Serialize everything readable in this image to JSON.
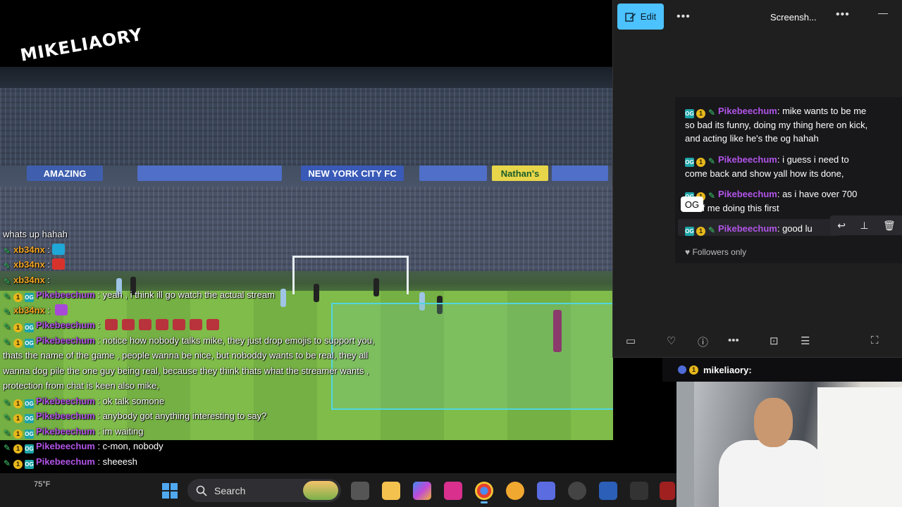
{
  "logo": {
    "text": "MIKELIAORY"
  },
  "stream": {
    "adboards": [
      "AMAZING",
      "NEW YORK CITY FC",
      "Nathan's"
    ],
    "chat": [
      {
        "user": "",
        "text": "whats up hahah",
        "badges": []
      },
      {
        "user": "xb34nx",
        "sep": " :",
        "text": "",
        "badges": [
          "pen"
        ],
        "color": "xb",
        "emote": "#1fa7d8"
      },
      {
        "user": "xb34nx",
        "sep": " :",
        "text": "",
        "badges": [
          "pen"
        ],
        "color": "xb",
        "emote": "#d8322c"
      },
      {
        "user": "xb34nx",
        "sep": " :",
        "text": "",
        "badges": [
          "pen"
        ],
        "color": "xb",
        "emote": ""
      },
      {
        "user": "Pikebeechum",
        "sep": " : ",
        "text": "yeah , i think ill go watch the actual stream",
        "badges": [
          "pen",
          "coin",
          "og"
        ],
        "color": "pike"
      },
      {
        "user": "xb34nx",
        "sep": " : ",
        "text": "",
        "badges": [
          "pen"
        ],
        "color": "xb",
        "emote": "#a84ad8"
      },
      {
        "user": "Pikebeechum",
        "sep": " : ",
        "text": "",
        "badges": [
          "pen",
          "coin",
          "og"
        ],
        "color": "pike",
        "emotes": 7
      },
      {
        "user": "Pikebeechum",
        "sep": " : ",
        "text": "notice how nobody talks mike, they just drop emojis to support you, thats the name of the game , people wanna be nice, but noboddy wants to be real, they all wanna dog pile the one guy being real, because they think thats what the streamer wants , protection from chat is keen also mike,",
        "badges": [
          "pen",
          "coin",
          "og"
        ],
        "color": "pike"
      },
      {
        "user": "Pikebeechum",
        "sep": " : ",
        "text": "ok talk somone",
        "badges": [
          "pen",
          "coin",
          "og"
        ],
        "color": "pike"
      },
      {
        "user": "Pikebeechum",
        "sep": " : ",
        "text": "anybody got anything interesting to say?",
        "badges": [
          "pen",
          "coin",
          "og"
        ],
        "color": "pike"
      },
      {
        "user": "Pikebeechum",
        "sep": " : ",
        "text": "im waiting",
        "badges": [
          "pen",
          "coin",
          "og"
        ],
        "color": "pike"
      },
      {
        "user": "Pikebeechum",
        "sep": " : ",
        "text": "c-mon, nobody",
        "badges": [
          "pen",
          "coin",
          "og"
        ],
        "color": "pike"
      },
      {
        "user": "Pikebeechum",
        "sep": " : ",
        "text": "sheeesh",
        "badges": [
          "pen",
          "coin",
          "og"
        ],
        "color": "pike"
      }
    ]
  },
  "right_chat_strip": {
    "user": "mikeliaory:"
  },
  "viewer": {
    "edit_label": "Edit",
    "more_label": "•••",
    "title": "Screensh...",
    "more2_label": "•••",
    "minimize_label": "—",
    "og_label": "OG",
    "followers_label": "Followers only",
    "messages": [
      {
        "user": "Pikebeechum",
        "lines": [
          "mike wants to be me",
          "so bad its funny, doing my thing here on kick,",
          "and acting like he's the og hahah"
        ]
      },
      {
        "user": "Pikebeechum",
        "lines": [
          "i guess i need to",
          "come back and show yall how its done,"
        ]
      },
      {
        "user": "Pikebeechum",
        "lines": [
          "as i have over 700",
          "os of me doing this first"
        ]
      },
      {
        "user": "Pikebeechum",
        "lines": [
          "good lu"
        ]
      }
    ],
    "bottom_icons": [
      "filmstrip-icon",
      "heart-icon",
      "info-icon",
      "more-icon",
      "crop-icon",
      "adjust-icon",
      "fullscreen-icon"
    ]
  },
  "taskbar": {
    "weather": "75°F",
    "search_label": "Search"
  },
  "colors": {
    "accent": "#4cc2ff",
    "pike": "#b154e8",
    "xb": "#f5a623"
  }
}
